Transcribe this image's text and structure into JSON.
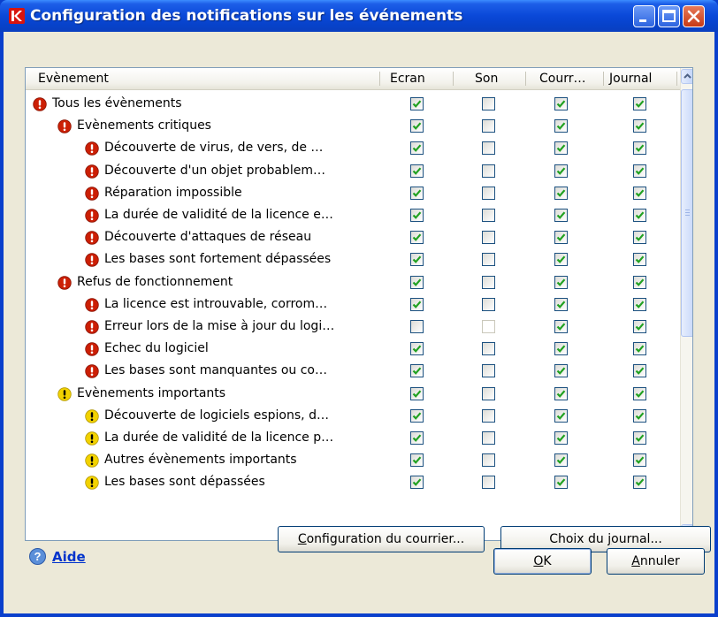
{
  "window": {
    "title": "Configuration des notifications sur les événements",
    "colors": {
      "titlebar": "#0a48d8",
      "client": "#ece9d8",
      "critical": "#cc1f05",
      "warning": "#f2d200"
    }
  },
  "table": {
    "headers": [
      "Evènement",
      "Ecran",
      "Son",
      "Courr…",
      "Journal"
    ],
    "rows": [
      {
        "label": "Tous les évènements",
        "level": 0,
        "severity": "critical",
        "checks": [
          "checked",
          "unchecked",
          "checked",
          "checked"
        ]
      },
      {
        "label": "Evènements critiques",
        "level": 1,
        "severity": "critical",
        "checks": [
          "checked",
          "unchecked",
          "checked",
          "checked"
        ]
      },
      {
        "label": "Découverte de virus, de vers, de …",
        "level": 2,
        "severity": "critical",
        "checks": [
          "checked",
          "unchecked",
          "checked",
          "checked"
        ]
      },
      {
        "label": "Découverte d'un objet probablem…",
        "level": 2,
        "severity": "critical",
        "checks": [
          "checked",
          "unchecked",
          "checked",
          "checked"
        ]
      },
      {
        "label": "Réparation impossible",
        "level": 2,
        "severity": "critical",
        "checks": [
          "checked",
          "unchecked",
          "checked",
          "checked"
        ]
      },
      {
        "label": "La durée de validité de la licence e…",
        "level": 2,
        "severity": "critical",
        "checks": [
          "checked",
          "unchecked",
          "checked",
          "checked"
        ]
      },
      {
        "label": "Découverte d'attaques de réseau",
        "level": 2,
        "severity": "critical",
        "checks": [
          "checked",
          "unchecked",
          "checked",
          "checked"
        ]
      },
      {
        "label": "Les bases sont fortement dépassées",
        "level": 2,
        "severity": "critical",
        "checks": [
          "checked",
          "unchecked",
          "checked",
          "checked"
        ]
      },
      {
        "label": "Refus de fonctionnement",
        "level": 1,
        "severity": "critical",
        "checks": [
          "checked",
          "unchecked",
          "checked",
          "checked"
        ]
      },
      {
        "label": "La licence est introuvable, corrom…",
        "level": 2,
        "severity": "critical",
        "checks": [
          "checked",
          "unchecked",
          "checked",
          "checked"
        ]
      },
      {
        "label": "Erreur lors de la mise à jour du logi…",
        "level": 2,
        "severity": "critical",
        "checks": [
          "unchecked",
          "disabled",
          "checked",
          "checked"
        ]
      },
      {
        "label": "Echec du logiciel",
        "level": 2,
        "severity": "critical",
        "checks": [
          "checked",
          "unchecked",
          "checked",
          "checked"
        ]
      },
      {
        "label": "Les bases sont manquantes ou co…",
        "level": 2,
        "severity": "critical",
        "checks": [
          "checked",
          "unchecked",
          "checked",
          "checked"
        ]
      },
      {
        "label": "Evènements importants",
        "level": 1,
        "severity": "warning",
        "checks": [
          "checked",
          "unchecked",
          "checked",
          "checked"
        ]
      },
      {
        "label": "Découverte de logiciels espions, d…",
        "level": 2,
        "severity": "warning",
        "checks": [
          "checked",
          "unchecked",
          "checked",
          "checked"
        ]
      },
      {
        "label": "La durée de validité de la licence p…",
        "level": 2,
        "severity": "warning",
        "checks": [
          "checked",
          "unchecked",
          "checked",
          "checked"
        ]
      },
      {
        "label": "Autres évènements importants",
        "level": 2,
        "severity": "warning",
        "checks": [
          "checked",
          "unchecked",
          "checked",
          "checked"
        ]
      },
      {
        "label": "Les bases sont dépassées",
        "level": 2,
        "severity": "warning",
        "checks": [
          "checked",
          "unchecked",
          "checked",
          "checked"
        ]
      }
    ]
  },
  "buttons": {
    "mail_config": {
      "pre": "",
      "u": "C",
      "post": "onfiguration du courrier..."
    },
    "journal": {
      "pre": "Choix du ",
      "u": "j",
      "post": "ournal..."
    },
    "ok": {
      "pre": "",
      "u": "O",
      "post": "K"
    },
    "cancel": {
      "pre": "",
      "u": "A",
      "post": "nnuler"
    }
  },
  "help": {
    "label": "Aide"
  }
}
